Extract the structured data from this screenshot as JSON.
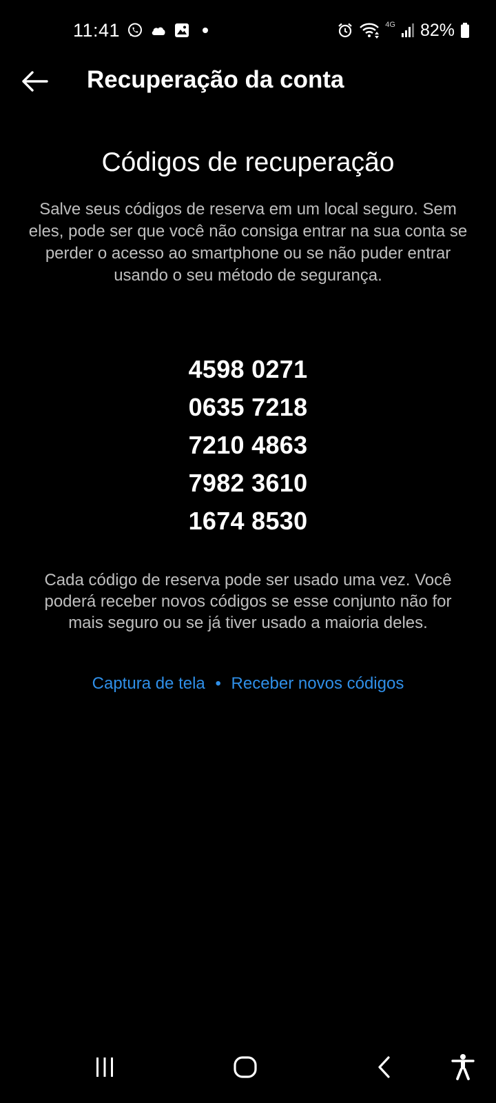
{
  "status_bar": {
    "time": "11:41",
    "network": "4G",
    "battery": "82%"
  },
  "header": {
    "title": "Recuperação da conta"
  },
  "content": {
    "section_title": "Códigos de recuperação",
    "intro": "Salve seus códigos de reserva em um local seguro. Sem eles, pode ser que você não consiga entrar na sua conta se perder o acesso ao smartphone ou se não puder entrar usando o seu método de segurança.",
    "codes": [
      "4598 0271",
      "0635 7218",
      "7210 4863",
      "7982 3610",
      "1674 8530"
    ],
    "info": "Cada código de reserva pode ser usado uma vez. Você poderá receber novos códigos se esse conjunto não for mais seguro ou se já tiver usado a maioria deles.",
    "links": {
      "screenshot": "Captura de tela",
      "separator": "•",
      "new_codes": "Receber novos códigos"
    }
  },
  "colors": {
    "background": "#000000",
    "text_primary": "#ffffff",
    "text_secondary": "#bfbfbf",
    "link": "#2f8fe8"
  },
  "icons": {
    "back": "arrow-left-icon",
    "whatsapp": "whatsapp-icon",
    "cloud": "cloud-icon",
    "gallery": "image-icon",
    "alarm": "alarm-icon",
    "wifi": "wifi-icon",
    "signal": "signal-icon",
    "battery": "battery-icon",
    "recents": "recents-icon",
    "home": "home-icon",
    "nav_back": "chevron-left-icon",
    "accessibility": "accessibility-icon"
  }
}
